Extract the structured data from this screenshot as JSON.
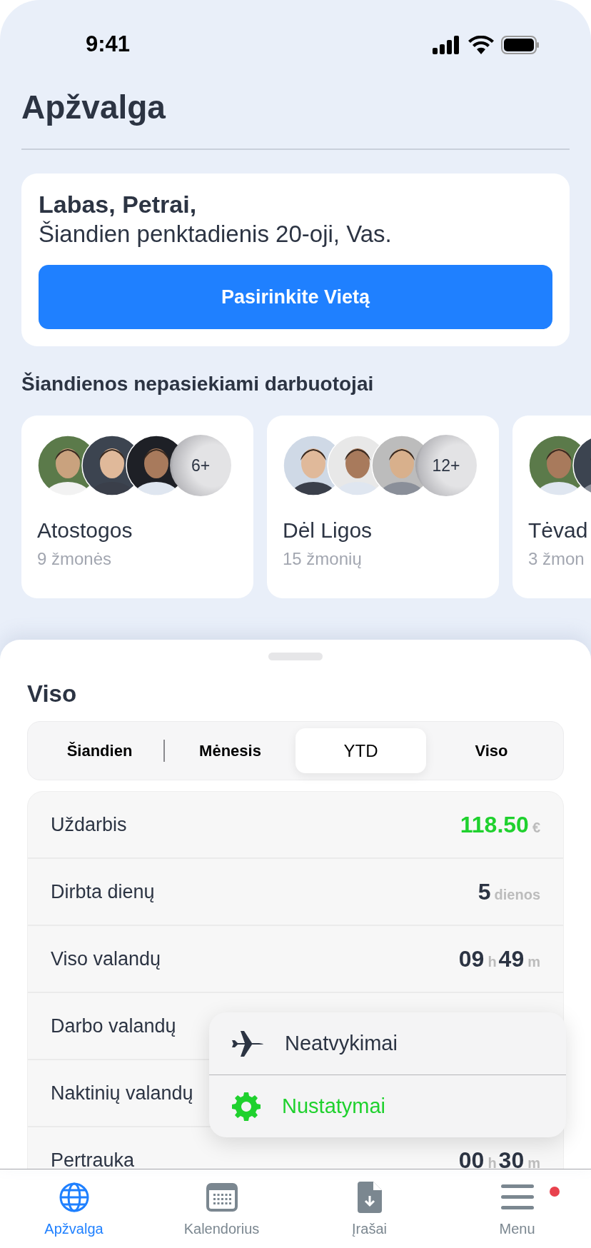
{
  "status_bar": {
    "time": "9:41"
  },
  "title": "Apžvalga",
  "greeting": {
    "name_line": "Labas, Petrai,",
    "date_line": "Šiandien penktadienis 20-oji, Vas.",
    "button": "Pasirinkite Vietą"
  },
  "absent_section": {
    "title": "Šiandienos nepasiekiami darbuotojai",
    "groups": [
      {
        "name": "Atostogos",
        "count": "9 žmonės",
        "more": "6+"
      },
      {
        "name": "Dėl Ligos",
        "count": "15 žmonių",
        "more": "12+"
      },
      {
        "name": "Tėvad",
        "count": "3 žmon"
      }
    ]
  },
  "summary": {
    "title": "Viso",
    "segments": [
      {
        "label": "Šiandien",
        "selected": false
      },
      {
        "label": "Mėnesis",
        "selected": false
      },
      {
        "label": "YTD",
        "selected": true
      },
      {
        "label": "Viso",
        "selected": false
      }
    ],
    "rows": [
      {
        "label": "Uždarbis",
        "value": [
          {
            "text": "118.50",
            "kind": "amount"
          },
          {
            "text": "€",
            "kind": "unit"
          }
        ]
      },
      {
        "label": "Dirbta dienų",
        "value": [
          {
            "text": "5",
            "kind": "number"
          },
          {
            "text": "dienos",
            "kind": "unit"
          }
        ]
      },
      {
        "label": "Viso valandų",
        "value": [
          {
            "text": "09",
            "kind": "number"
          },
          {
            "text": "h",
            "kind": "unit"
          },
          {
            "text": "49",
            "kind": "number"
          },
          {
            "text": "m",
            "kind": "unit"
          }
        ]
      },
      {
        "label": "Darbo valandų"
      },
      {
        "label": "Naktinių valandų"
      },
      {
        "label": "Pertrauka",
        "value": [
          {
            "text": "00",
            "kind": "number"
          },
          {
            "text": "h",
            "kind": "unit"
          },
          {
            "text": "30",
            "kind": "number"
          },
          {
            "text": "m",
            "kind": "unit"
          }
        ]
      }
    ]
  },
  "menu_popup": {
    "items": [
      {
        "label": "Neatvykimai",
        "kind": "airplane",
        "selected": false
      },
      {
        "label": "Nustatymai",
        "kind": "gear",
        "selected": true
      }
    ]
  },
  "tab_bar": [
    {
      "label": "Apžvalga",
      "kind": "globe",
      "selected": true,
      "badge": false
    },
    {
      "label": "Kalendorius",
      "kind": "calendar",
      "selected": false,
      "badge": false
    },
    {
      "label": "Įrašai",
      "kind": "document",
      "selected": false,
      "badge": false
    },
    {
      "label": "Menu",
      "kind": "menu",
      "selected": false,
      "badge": true
    }
  ]
}
